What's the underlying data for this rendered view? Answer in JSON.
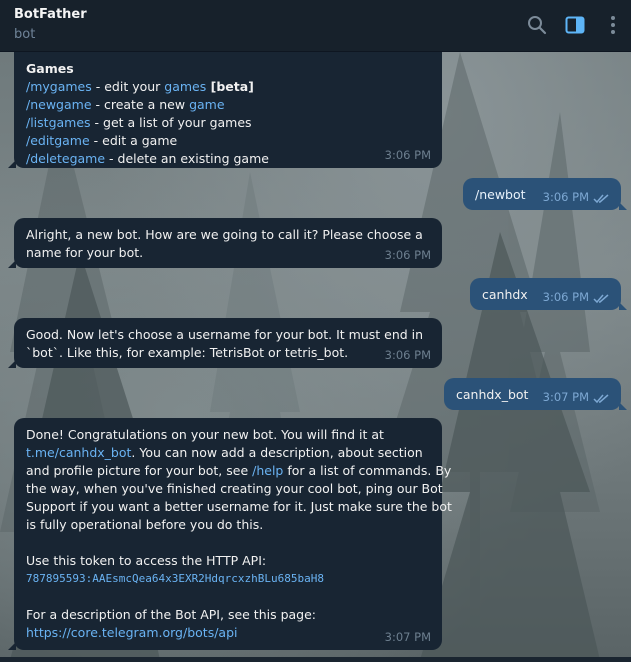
{
  "header": {
    "title": "BotFather",
    "subtitle": "bot"
  },
  "messages": {
    "m1": {
      "heading": "Games",
      "lines": [
        {
          "cmd": "/mygames",
          "text_a": " - edit your ",
          "link": "games",
          "text_b": " [beta]"
        },
        {
          "cmd": "/newgame",
          "text_a": " - create a new ",
          "link": "game"
        },
        {
          "cmd": "/listgames",
          "text_a": " - get a list of your games"
        },
        {
          "cmd": "/editgame",
          "text_a": " - edit a game"
        },
        {
          "cmd": "/deletegame",
          "text_a": " - delete an existing game"
        }
      ],
      "time": "3:06 PM"
    },
    "m2": {
      "text": "/newbot",
      "time": "3:06 PM"
    },
    "m3": {
      "line1": "Alright, a new bot. How are we going to call it? Please choose a",
      "line2": "name for your bot.",
      "time": "3:06 PM"
    },
    "m4": {
      "text": "canhdx",
      "time": "3:06 PM"
    },
    "m5": {
      "line1": "Good. Now let's choose a username for your bot. It must end in",
      "line2": "`bot`. Like this, for example: TetrisBot or tetris_bot.",
      "time": "3:06 PM"
    },
    "m6": {
      "text": "canhdx_bot",
      "time": "3:07 PM"
    },
    "m7": {
      "l1": "Done! Congratulations on your new bot. You will find it at",
      "l2_link": "t.me/canhdx_bot",
      "l2_text": ". You can now add a description, about section",
      "l3": "and profile picture for your bot, see ",
      "l3_cmd": "/help",
      "l3_text": " for a list of commands. By",
      "l4": "the way, when you've finished creating your cool bot, ping our Bot",
      "l5": "Support if you want a better username for it. Just make sure the bot",
      "l6": "is fully operational before you do this.",
      "l7": "Use this token to access the HTTP API:",
      "token": "787895593:AAEsmcQea64x3EXR2HdqrcxzhBLu685baH8",
      "l8": "For a description of the Bot API, see this page:",
      "api_link": "https://core.telegram.org/bots/api",
      "time": "3:07 PM"
    }
  },
  "colors": {
    "incoming_bubble": "#182533",
    "outgoing_bubble": "#2b5278",
    "link": "#6ab3f3",
    "header_bg": "#17212b"
  },
  "icons": {
    "search": "search-icon",
    "panel": "sidebar-toggle-icon",
    "more": "more-vertical-icon",
    "read": "double-check-icon"
  }
}
